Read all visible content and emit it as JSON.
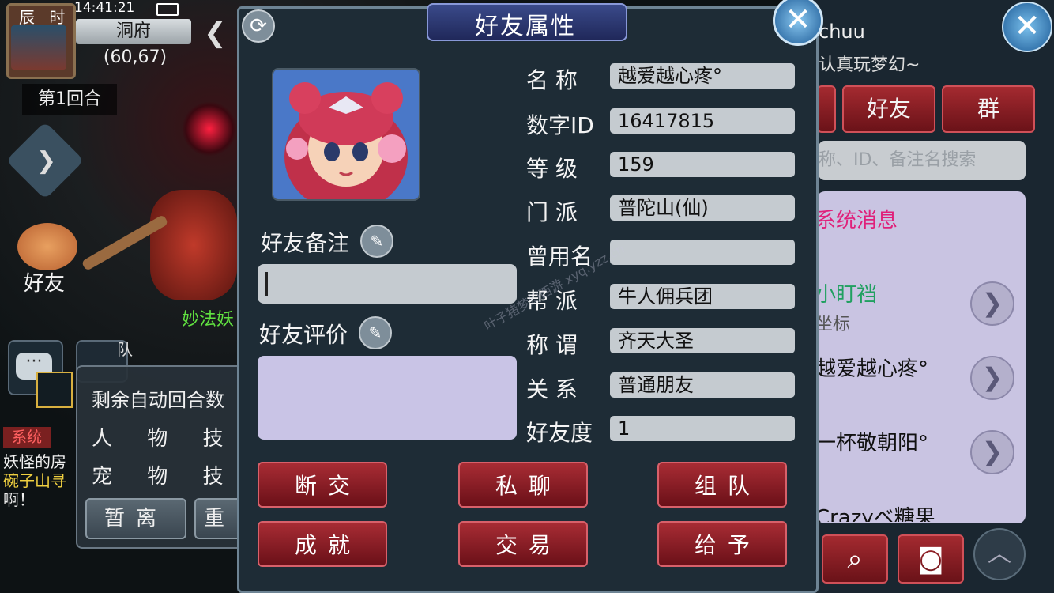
{
  "status": {
    "time_period": "辰 时",
    "clock": "14:41:21"
  },
  "map": {
    "location": "洞府",
    "coords": "(60,67)"
  },
  "battle": {
    "round": "第1回合",
    "monster_name": "妙法妖"
  },
  "left_hud": {
    "friend_label": "好友",
    "team_label": "队"
  },
  "auto_panel": {
    "remaining_text": "剩余自动回合数",
    "row1": "人 物 技 能",
    "row2": "宠 物 技 能",
    "btn_away": "暂离",
    "btn_reset": "重"
  },
  "chat": {
    "system_tag": "系统",
    "line1": "妖怪的房",
    "line2": "碗子山寻",
    "line3": "啊！"
  },
  "right_panel": {
    "name": "chuu",
    "signature": "认真玩梦幻~",
    "tabs": [
      "",
      "好友",
      "群"
    ],
    "search_placeholder": "称、ID、备注名搜索",
    "items": [
      {
        "name": "系统消息",
        "sub": "",
        "color": "#e0207a"
      },
      {
        "name": "小盯裆",
        "sub": "坐标",
        "color": "#20a060"
      },
      {
        "name": "越爱越心疼°",
        "sub": "",
        "color": "#111111"
      },
      {
        "name": "一杯敬朝阳°",
        "sub": "",
        "color": "#111111"
      },
      {
        "name": "Crazyベ糖果",
        "sub": "",
        "color": "#111111"
      }
    ],
    "arrow_glyph": "❯",
    "search_icon": "search-icon",
    "bag_icon": "bag-icon"
  },
  "dialog": {
    "title": "好友属性",
    "fields": [
      {
        "label": "名  称",
        "value": "越爱越心疼°"
      },
      {
        "label": "数字ID",
        "value": "16417815"
      },
      {
        "label": "等  级",
        "value": "159"
      },
      {
        "label": "门  派",
        "value": "普陀山(仙)"
      },
      {
        "label": "曾用名",
        "value": ""
      },
      {
        "label": "帮  派",
        "value": "牛人佣兵团"
      },
      {
        "label": "称  谓",
        "value": "齐天大圣"
      },
      {
        "label": "关  系",
        "value": "普通朋友"
      },
      {
        "label": "好友度",
        "value": "1"
      }
    ],
    "remark_label": "好友备注",
    "remark_value": "",
    "review_label": "好友评价",
    "review_value": "",
    "buttons": [
      "断交",
      "私聊",
      "组队",
      "成就",
      "交易",
      "给予"
    ],
    "watermark": "叶子猪梦幻西游 xyq.yzz.cn"
  },
  "colors": {
    "dialog_bg": "#1e2c36",
    "button_red": "#a82c34",
    "field_bg": "#c5cbd0",
    "review_bg": "#c9c4e6"
  }
}
